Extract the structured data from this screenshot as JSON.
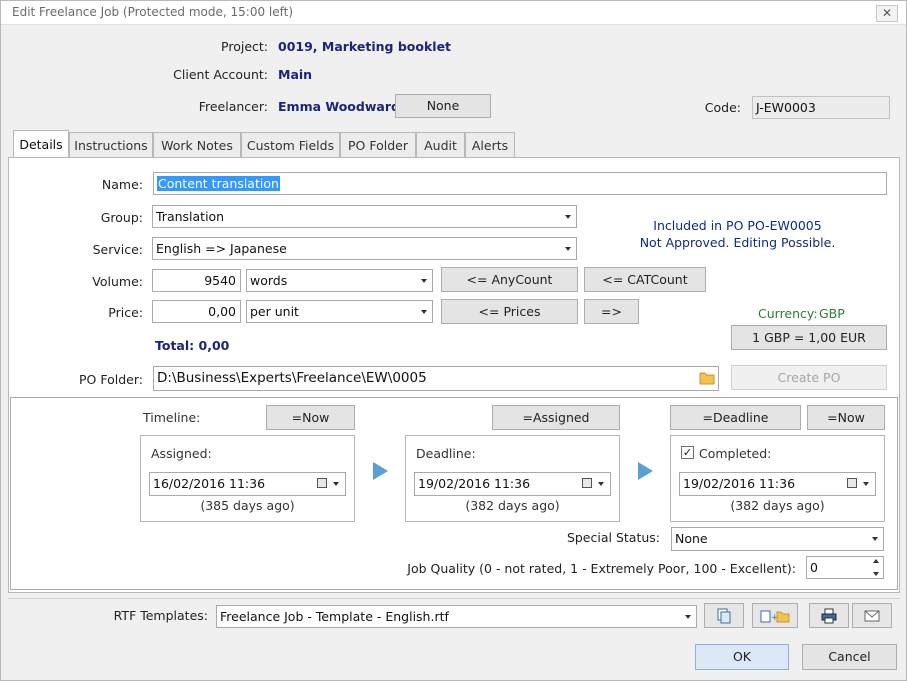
{
  "window": {
    "title": "Edit Freelance Job (Protected mode, 15:00 left)",
    "close_glyph": "✕"
  },
  "header": {
    "project_label": "Project:",
    "project_value": "0019, Marketing booklet",
    "client_label": "Client Account:",
    "client_value": "Main",
    "freelancer_label": "Freelancer:",
    "freelancer_value": "Emma Woodward",
    "none_button": "None",
    "code_label": "Code:",
    "code_value": "J-EW0003"
  },
  "tabs": [
    {
      "label": "Details",
      "active": true
    },
    {
      "label": "Instructions"
    },
    {
      "label": "Work Notes"
    },
    {
      "label": "Custom Fields"
    },
    {
      "label": "PO Folder"
    },
    {
      "label": "Audit"
    },
    {
      "label": "Alerts"
    }
  ],
  "details": {
    "name_label": "Name:",
    "name_value": "Content translation",
    "group_label": "Group:",
    "group_value": "Translation",
    "service_label": "Service:",
    "service_value": "English => Japanese",
    "volume_label": "Volume:",
    "volume_value": "9540",
    "volume_unit": "words",
    "anycount_button": "<= AnyCount",
    "catcount_button": "<= CATCount",
    "price_label": "Price:",
    "price_value": "0,00",
    "price_unit": "per unit",
    "prices_button": "<= Prices",
    "arrow_button": "=>",
    "total": "Total: 0,00",
    "po_info_line1": "Included in PO PO-EW0005",
    "po_info_line2": "Not Approved. Editing Possible.",
    "currency_label": "Currency:",
    "currency_value": "GBP",
    "rate_button": "1 GBP = 1,00 EUR",
    "po_folder_label": "PO Folder:",
    "po_folder_value": "D:\\Business\\Experts\\Freelance\\EW\\0005",
    "create_po_button": "Create PO"
  },
  "timeline": {
    "label": "Timeline:",
    "now_button_1": "=Now",
    "assigned_button": "=Assigned",
    "deadline_button": "=Deadline",
    "now_button_2": "=Now",
    "assigned_label": "Assigned:",
    "assigned_date": "16/02/2016 11:36",
    "assigned_ago": "(385 days ago)",
    "deadline_label": "Deadline:",
    "deadline_date": "19/02/2016 11:36",
    "deadline_ago": "(382 days ago)",
    "completed_label": "Completed:",
    "completed_checked": "✓",
    "completed_date": "19/02/2016 11:36",
    "completed_ago": "(382 days ago)",
    "special_status_label": "Special Status:",
    "special_status_value": "None",
    "job_quality_label": "Job Quality (0 - not rated, 1 - Extremely Poor, 100 - Excellent):",
    "job_quality_value": "0"
  },
  "footer": {
    "rtf_label": "RTF Templates:",
    "rtf_value": "Freelance Job - Template - English.rtf",
    "ok_button": "OK",
    "cancel_button": "Cancel",
    "icons": [
      "copy-document-icon",
      "add-folder-icon",
      "printer-icon",
      "email-icon"
    ]
  },
  "colors": {
    "accent_blue": "#1a237e",
    "green": "#2e7d32",
    "selection": "#3399ff"
  }
}
